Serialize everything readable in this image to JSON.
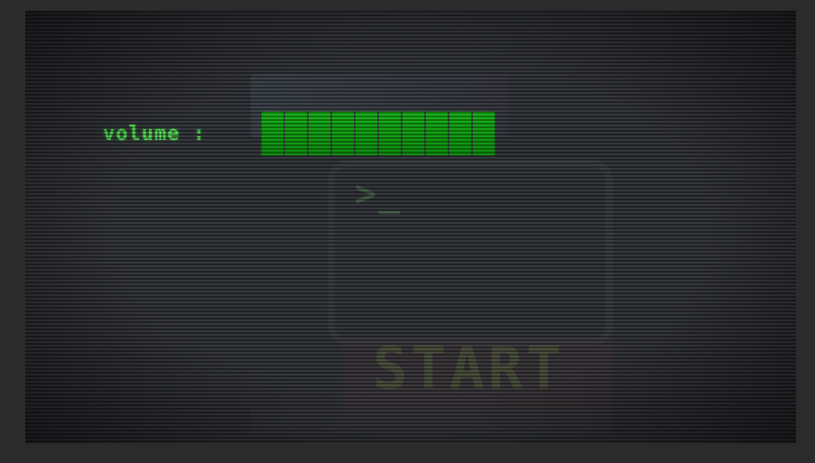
{
  "osd": {
    "label": "volume :",
    "volume_level": 1.0,
    "segments": 10,
    "color": "#4fe24f",
    "bar_color": "#12a812"
  },
  "background": {
    "ghost_prompt": ">_",
    "ghost_button": "START"
  }
}
